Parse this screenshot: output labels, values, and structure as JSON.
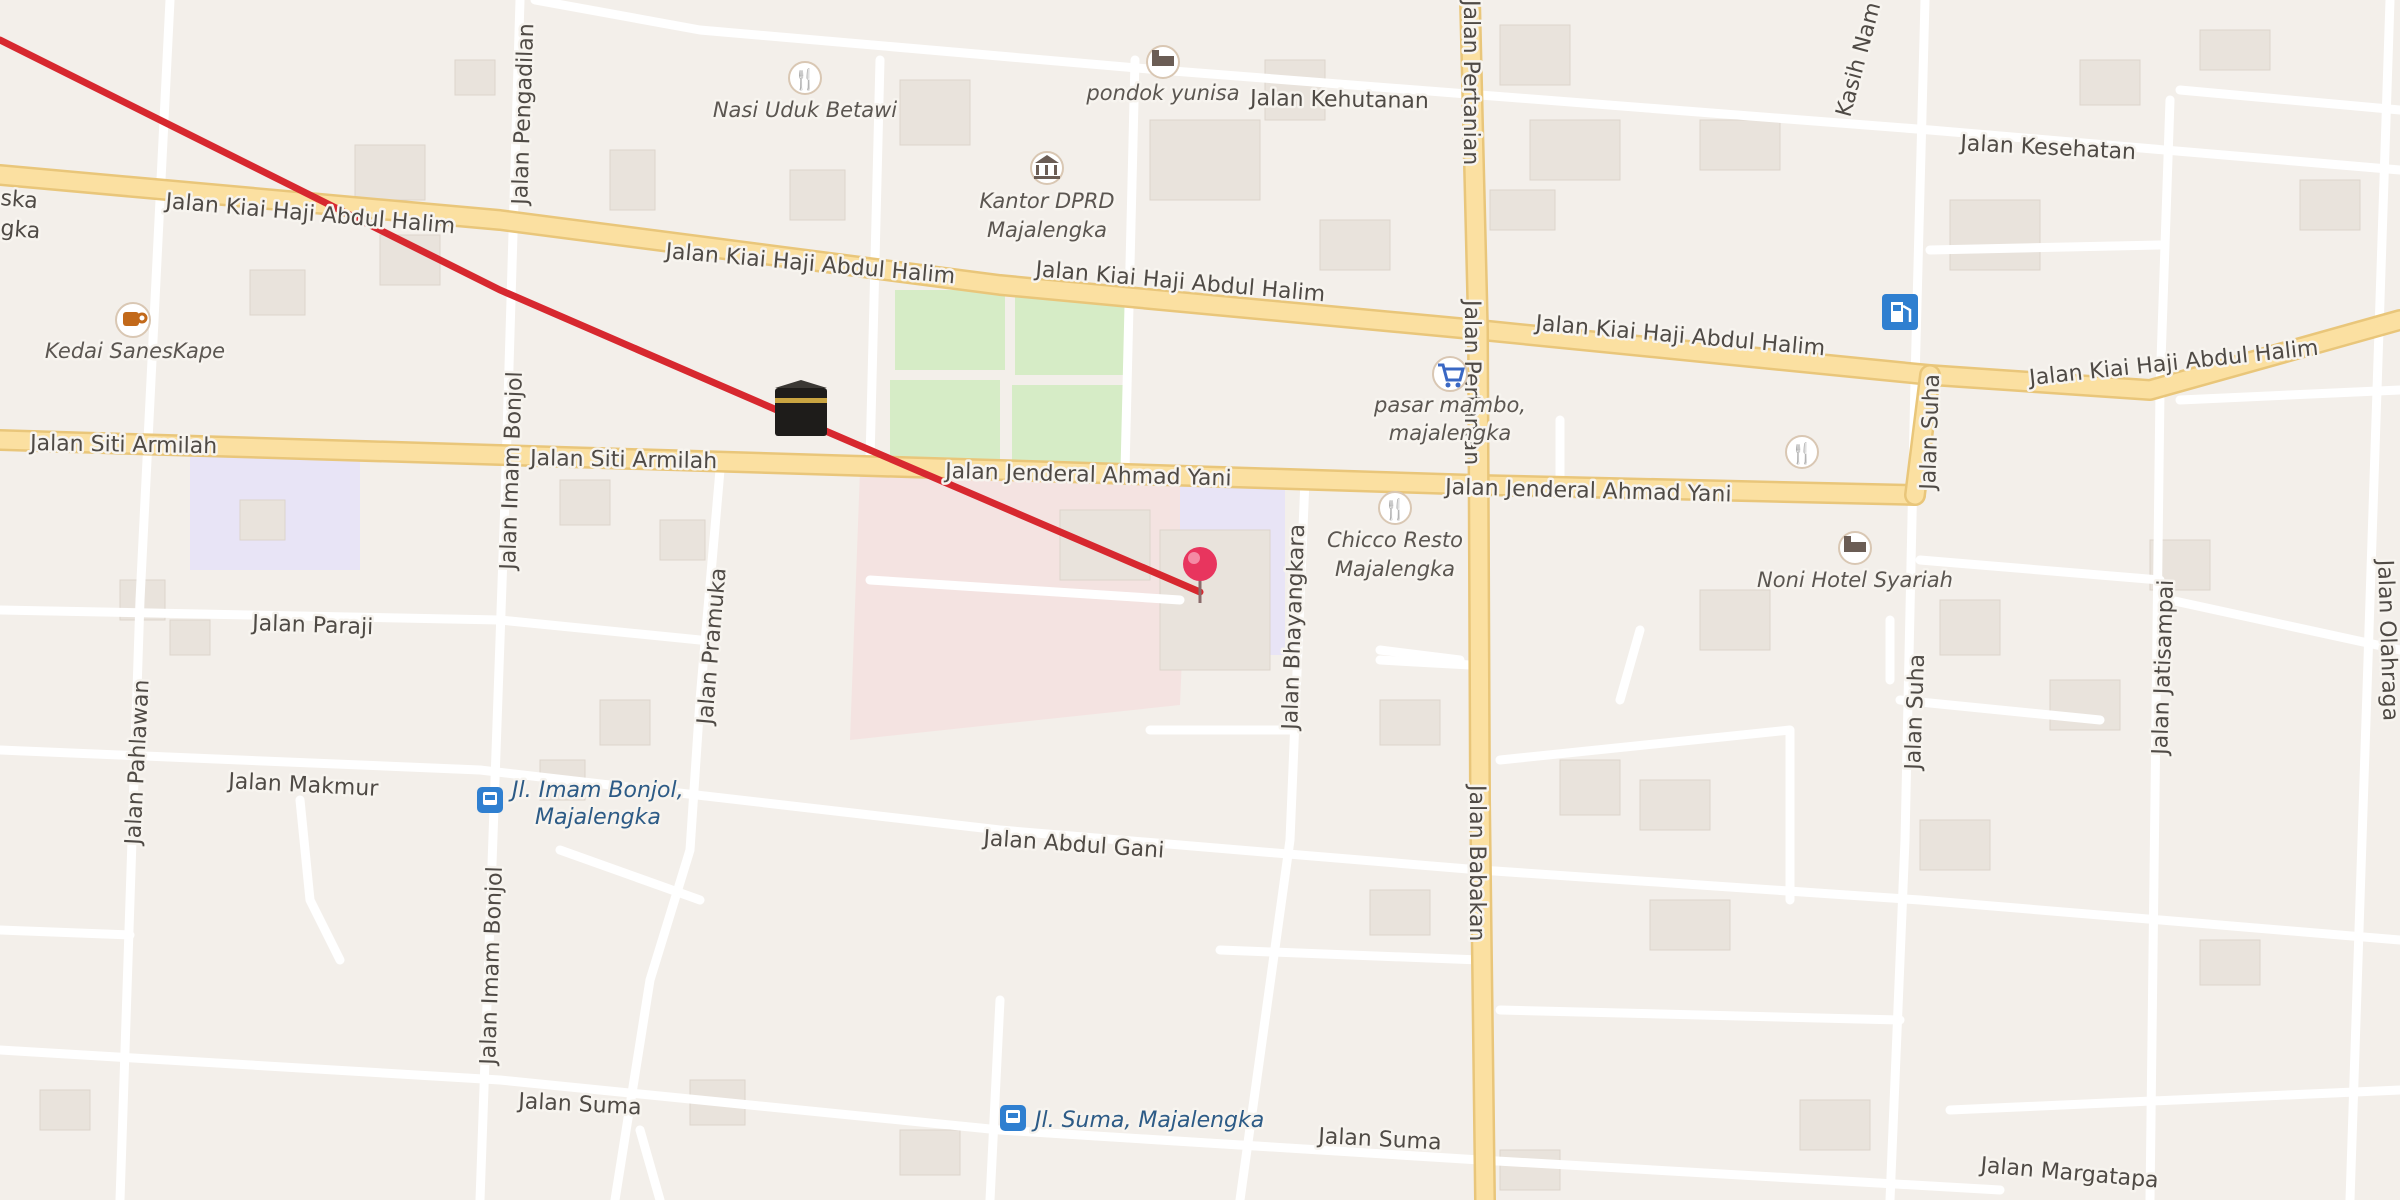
{
  "colors": {
    "land": "#f3efea",
    "main_road": "#fbe0a1",
    "main_road_casing": "#e9c67a",
    "minor_road": "#ffffff",
    "park": "#d6ecc6",
    "hospital_area": "#f4e3e1",
    "school_area": "#e8e4f6",
    "route_line": "#d7282f",
    "pin": "#e8355e",
    "poi_icon": "#b5651d",
    "transit_icon": "#2f7fd0",
    "fuel_icon": "#2f7fd0"
  },
  "roads": {
    "kiai_haji_abdul_halim": "Jalan Kiai Haji Abdul Halim",
    "siti_armilah": "Jalan Siti Armilah",
    "jenderal_ahmad_yani": "Jalan Jenderal Ahmad Yani",
    "pengadilan": "Jalan Pengadilan",
    "kehutanan": "Jalan Kehutanan",
    "kesehatan": "Jalan Kesehatan",
    "kasih_nam": "Kasih Nam",
    "pertanian": "Jalan Pertanian",
    "imam_bonjol": "Jalan Imam Bonjol",
    "paraji": "Jalan Paraji",
    "pramuka": "Jalan Pramuka",
    "bhayangkara": "Jalan Bhayangkara",
    "pahlawan": "Jalan Pahlawan",
    "makmur": "Jalan Makmur",
    "abdul_gani": "Jalan Abdul Gani",
    "babakan": "Jalan Babakan",
    "suha": "Jalan Suha",
    "jatisampai": "Jalan Jatisampai",
    "olahraga": "Jalan Olahraga",
    "suma": "Jalan Suma",
    "margatapa": "Jalan Margatapa",
    "ska_fragment_1": "ska",
    "ska_fragment_2": "gka"
  },
  "pois": {
    "nasi_uduk": {
      "label": "Nasi Uduk Betawi",
      "icon": "restaurant-icon"
    },
    "pondok_yunisa": {
      "label": "pondok yunisa",
      "icon": "lodging-icon"
    },
    "dprd_line1": "Kantor DPRD",
    "dprd_line2": "Majalengka",
    "dprd_icon": "government-building-icon",
    "kedai": {
      "label": "Kedai SanesKape",
      "icon": "cafe-icon"
    },
    "pasar_line1": "pasar mambo,",
    "pasar_line2": "majalengka",
    "pasar_icon": "shopping-cart-icon",
    "chicco_line1": "Chicco Resto",
    "chicco_line2": "Majalengka",
    "chicco_icon": "restaurant-icon",
    "noni": {
      "label": "Noni Hotel Syariah",
      "icon": "lodging-icon"
    },
    "unnamed_restaurant_icon": "restaurant-icon",
    "fuel_icon": "fuel-station-icon",
    "kaaba_icon": "kaaba-icon"
  },
  "transit": {
    "imam_bonjol_line1": "Jl. Imam Bonjol,",
    "imam_bonjol_line2": "Majalengka",
    "suma_stop": "Jl. Suma, Majalengka",
    "icon": "bus-stop-icon"
  },
  "markers": {
    "pin_icon": "location-pin-icon",
    "route": "route-line"
  }
}
